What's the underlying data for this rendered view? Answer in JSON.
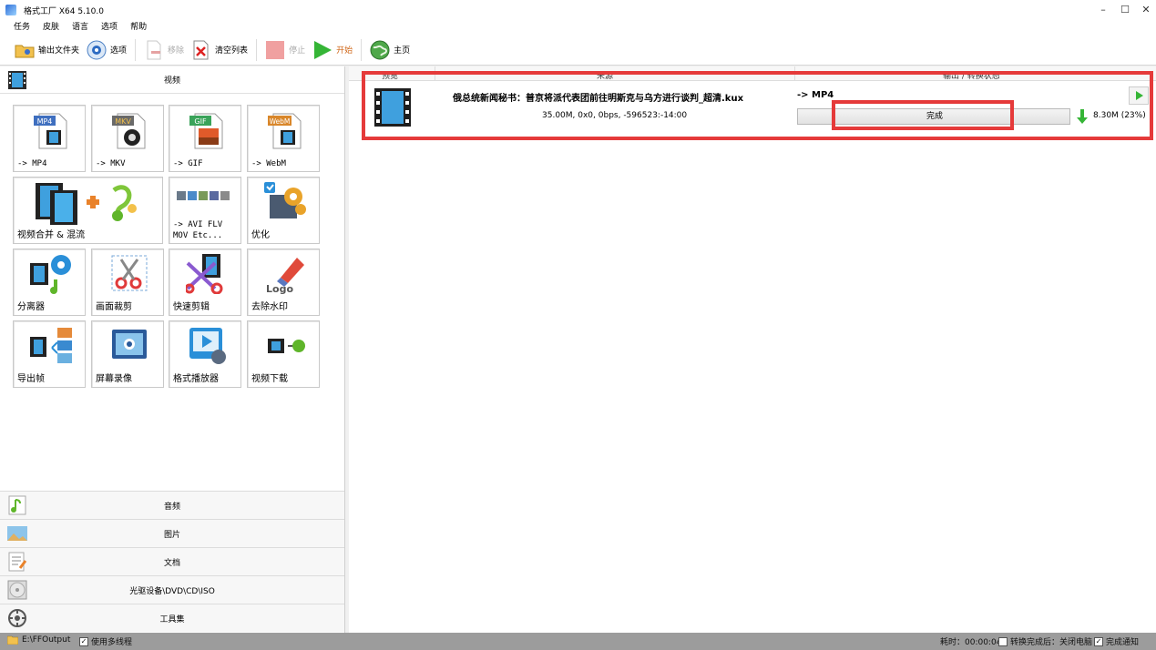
{
  "window": {
    "title": "格式工厂 X64 5.10.0",
    "minimize": "–",
    "maximize": "☐",
    "close": "✕"
  },
  "menu": [
    "任务",
    "皮肤",
    "语言",
    "选项",
    "帮助"
  ],
  "toolbar": {
    "output_folder": "输出文件夹",
    "options": "选项",
    "remove": "移除",
    "clear_list": "清空列表",
    "stop": "停止",
    "start": "开始",
    "home": "主页"
  },
  "sidebar": {
    "video_header": "视频",
    "tiles": [
      {
        "label": "-> MP4",
        "badge": "MP4",
        "badge_color": "#3f6fbf"
      },
      {
        "label": "-> MKV",
        "badge": "MKV",
        "badge_color": "#6a6a6a"
      },
      {
        "label": "-> GIF",
        "badge": "GIF",
        "badge_color": "#3aa35a"
      },
      {
        "label": "-> WebM",
        "badge": "WebM",
        "badge_color": "#d9872b"
      },
      {
        "label": "视频合并 & 混流"
      },
      {
        "label": "-> AVI FLV",
        "label2": "MOV Etc..."
      },
      {
        "label": "优化"
      },
      {
        "label": "分离器"
      },
      {
        "label": "画面裁剪"
      },
      {
        "label": "快速剪辑"
      },
      {
        "label": "去除水印"
      },
      {
        "label": "导出帧"
      },
      {
        "label": "屏幕录像"
      },
      {
        "label": "格式播放器"
      },
      {
        "label": "视频下载"
      }
    ],
    "categories": [
      "音频",
      "图片",
      "文档",
      "光驱设备\\DVD\\CD\\ISO",
      "工具集"
    ]
  },
  "columns": {
    "preview": "预览",
    "source": "来源",
    "output": "输出 / 转换状态"
  },
  "task": {
    "name": "俄总统新闻秘书：普京将派代表团前往明斯克与乌方进行谈判_超清.kux",
    "info": "35.00M, 0x0, 0bps, -596523:-14:00",
    "output_format": "-> MP4",
    "status": "完成",
    "progress": 1.0,
    "size": "8.30M",
    "percent": "(23%)"
  },
  "status_bar": {
    "output_path": "E:\\FFOutput",
    "multithread": "使用多线程",
    "elapsed": "耗时：00:00:04",
    "after_done": "转换完成后：关闭电脑",
    "notify": "完成通知"
  },
  "colors": {
    "highlight": "#e53a3a",
    "status_bar": "#9c9c9c",
    "accent_green": "#35b536"
  }
}
